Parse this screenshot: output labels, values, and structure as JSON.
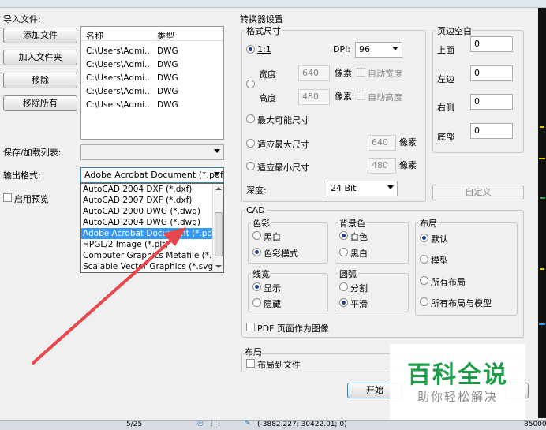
{
  "import": {
    "section_label": "导入文件:",
    "buttons": {
      "add_file": "添加文件",
      "add_folder": "加入文件夹",
      "remove": "移除",
      "remove_all": "移除所有"
    },
    "columns": {
      "name": "名称",
      "type": "类型"
    },
    "files": [
      {
        "name": "C:\\Users\\Admi...",
        "type": "DWG"
      },
      {
        "name": "C:\\Users\\Admi...",
        "type": "DWG"
      },
      {
        "name": "C:\\Users\\Admi...",
        "type": "DWG"
      },
      {
        "name": "C:\\Users\\Admi...",
        "type": "DWG"
      },
      {
        "name": "C:\\Users\\Admi...",
        "type": "DWG"
      }
    ]
  },
  "save_list": {
    "label": "保存/加载列表:",
    "value": ""
  },
  "output": {
    "label": "输出格式:",
    "selected": "Adobe Acrobat Document (*.pdf,",
    "options": [
      "AutoCAD 2004 DXF (*.dxf)",
      "AutoCAD 2007 DXF (*.dxf)",
      "AutoCAD 2000 DWG (*.dwg)",
      "AutoCAD 2004 DWG (*.dwg)",
      "Adobe Acrobat Document (*.pdf)",
      "HPGL/2 Image (*.plt)",
      "Computer Graphics Metafile (*.cg",
      "Scalable Vector Graphics (*.svg)"
    ],
    "highlighted_index": 4
  },
  "preview": {
    "label": "启用预览"
  },
  "converter": {
    "title": "转换器设置",
    "format": {
      "title": "格式尺寸",
      "one_to_one": "1:1",
      "dpi_label": "DPI:",
      "dpi_value": "96",
      "width_label": "宽度",
      "width_value": "640",
      "pixel_unit": "像素",
      "auto_width": "自动宽度",
      "height_label": "高度",
      "height_value": "480",
      "auto_height": "自动高度",
      "max_possible": "最大可能尺寸",
      "fit_max": "适应最大尺寸",
      "fit_max_value": "640",
      "fit_min": "适应最小尺寸",
      "fit_min_value": "480",
      "depth_label": "深度:",
      "depth_value": "24 Bit"
    },
    "margins": {
      "title": "页边空白",
      "top_label": "上面",
      "top_value": "0",
      "left_label": "左边",
      "left_value": "0",
      "right_label": "右侧",
      "right_value": "0",
      "bottom_label": "底部",
      "bottom_value": "0",
      "custom_button": "自定义"
    },
    "cad": {
      "title": "CAD",
      "color": {
        "title": "色彩",
        "bw": "黑白",
        "color_mode": "色彩模式"
      },
      "background": {
        "title": "背景色",
        "white": "白色",
        "black": "黑白"
      },
      "layout": {
        "title": "布局",
        "default": "默认",
        "model": "模型",
        "all_layouts": "所有布局",
        "all_layouts_model": "所有布局与模型"
      },
      "lineweight": {
        "title": "线宽",
        "show": "显示",
        "hide": "隐藏"
      },
      "arc": {
        "title": "圆弧",
        "split": "分割",
        "smooth": "平滑"
      },
      "pdf_as_image": "PDF 页面作为图像"
    },
    "layout_section": {
      "title": "布局",
      "layout_to_file": "布局到文件"
    }
  },
  "start_button": "开始",
  "watermark": {
    "title": "百科全说",
    "subtitle": "助你轻松解决"
  },
  "statusbar": {
    "page": "5/25",
    "coords": "(-3882.227; 30422.01; 0)",
    "right": "85000"
  },
  "colors": {
    "arrow": "#e8474b",
    "selection": "#3399ff",
    "watermark_green": "#1f9c4a"
  }
}
